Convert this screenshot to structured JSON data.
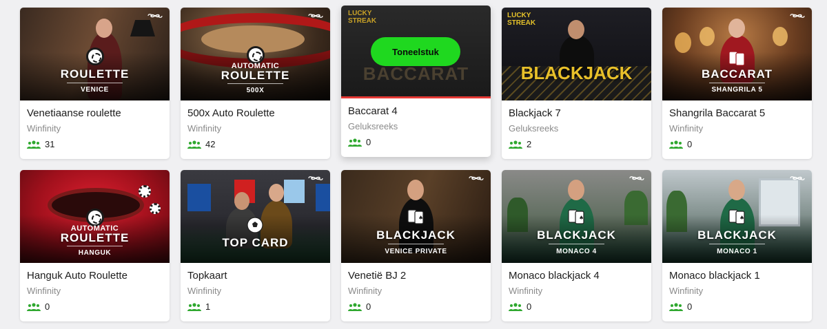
{
  "colors": {
    "accent_green": "#1fd81f",
    "players_icon": "#2fa82f",
    "hover_bar": "#e53935"
  },
  "games": [
    {
      "name": "Venetiaanse roulette",
      "studio": "Winfinity",
      "players": "31",
      "brand": {
        "line1": "",
        "title": "ROULETTE",
        "sub": "VENICE"
      }
    },
    {
      "name": "500x Auto Roulette",
      "studio": "Winfinity",
      "players": "42",
      "brand": {
        "line1": "AUTOMATIC",
        "title": "ROULETTE",
        "sub": "500X"
      }
    },
    {
      "name": "Baccarat 4",
      "studio": "Geluksreeks",
      "players": "0",
      "brand": {
        "line1": "LUCKY STREAK",
        "title": "BACCARAT",
        "sub": ""
      },
      "play_label": "Toneelstuk"
    },
    {
      "name": "Blackjack 7",
      "studio": "Geluksreeks",
      "players": "2",
      "brand": {
        "line1": "LUCKY STREAK",
        "title": "BLACKJACK",
        "sub": ""
      }
    },
    {
      "name": "Shangrila Baccarat 5",
      "studio": "Winfinity",
      "players": "0",
      "brand": {
        "line1": "",
        "title": "BACCARAT",
        "sub": "SHANGRILA 5"
      }
    },
    {
      "name": "Hanguk Auto Roulette",
      "studio": "Winfinity",
      "players": "0",
      "brand": {
        "line1": "AUTOMATIC",
        "title": "ROULETTE",
        "sub": "HANGUK"
      }
    },
    {
      "name": "Topkaart",
      "studio": "Winfinity",
      "players": "1",
      "brand": {
        "line1": "",
        "title": "TOP CARD",
        "sub": ""
      }
    },
    {
      "name": "Venetië BJ 2",
      "studio": "Winfinity",
      "players": "0",
      "brand": {
        "line1": "",
        "title": "BLACKJACK",
        "sub": "VENICE PRIVATE"
      }
    },
    {
      "name": "Monaco blackjack 4",
      "studio": "Winfinity",
      "players": "0",
      "brand": {
        "line1": "",
        "title": "BLACKJACK",
        "sub": "MONACO 4"
      }
    },
    {
      "name": "Monaco blackjack 1",
      "studio": "Winfinity",
      "players": "0",
      "brand": {
        "line1": "",
        "title": "BLACKJACK",
        "sub": "MONACO 1"
      }
    }
  ]
}
